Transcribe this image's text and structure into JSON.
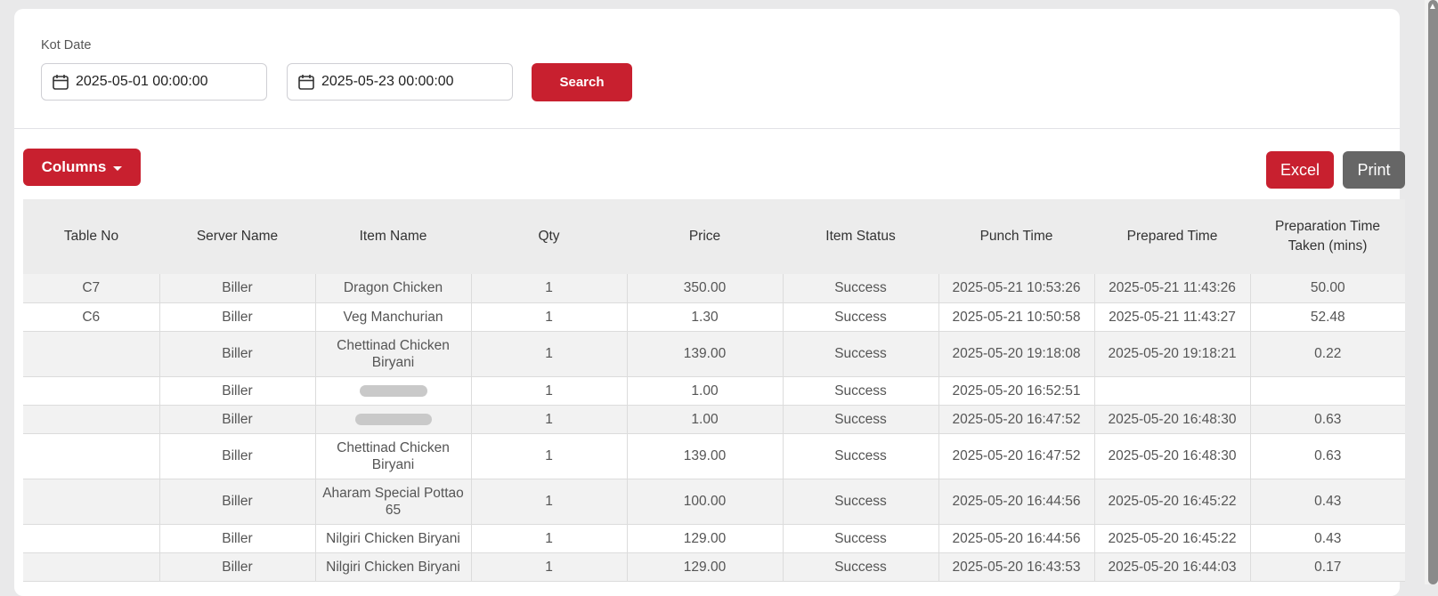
{
  "filters": {
    "label": "Kot Date",
    "from_date": "2025-05-01 00:00:00",
    "to_date": "2025-05-23 00:00:00",
    "search_label": "Search"
  },
  "toolbar": {
    "columns_label": "Columns",
    "excel_label": "Excel",
    "print_label": "Print"
  },
  "colors": {
    "accent": "#c8202f",
    "print_button": "#666666",
    "header_bg": "#ececec"
  },
  "table": {
    "headers": [
      "Table No",
      "Server Name",
      "Item Name",
      "Qty",
      "Price",
      "Item Status",
      "Punch Time",
      "Prepared Time",
      "Preparation Time Taken (mins)"
    ],
    "rows": [
      {
        "table_no": "C7",
        "server": "Biller",
        "item": "Dragon Chicken",
        "qty": "1",
        "price": "350.00",
        "status": "Success",
        "punch": "2025-05-21 10:53:26",
        "prepared": "2025-05-21 11:43:26",
        "taken": "50.00"
      },
      {
        "table_no": "C6",
        "server": "Biller",
        "item": "Veg Manchurian",
        "qty": "1",
        "price": "1.30",
        "status": "Success",
        "punch": "2025-05-21 10:50:58",
        "prepared": "2025-05-21 11:43:27",
        "taken": "52.48"
      },
      {
        "table_no": "",
        "server": "Biller",
        "item": "Chettinad Chicken Biryani",
        "qty": "1",
        "price": "139.00",
        "status": "Success",
        "punch": "2025-05-20 19:18:08",
        "prepared": "2025-05-20 19:18:21",
        "taken": "0.22"
      },
      {
        "table_no": "",
        "server": "Biller",
        "item": "",
        "qty": "1",
        "price": "1.00",
        "status": "Success",
        "punch": "2025-05-20 16:52:51",
        "prepared": "",
        "taken": ""
      },
      {
        "table_no": "",
        "server": "Biller",
        "item": "",
        "qty": "1",
        "price": "1.00",
        "status": "Success",
        "punch": "2025-05-20 16:47:52",
        "prepared": "2025-05-20 16:48:30",
        "taken": "0.63"
      },
      {
        "table_no": "",
        "server": "Biller",
        "item": "Chettinad Chicken Biryani",
        "qty": "1",
        "price": "139.00",
        "status": "Success",
        "punch": "2025-05-20 16:47:52",
        "prepared": "2025-05-20 16:48:30",
        "taken": "0.63"
      },
      {
        "table_no": "",
        "server": "Biller",
        "item": "Aharam Special Pottao 65",
        "qty": "1",
        "price": "100.00",
        "status": "Success",
        "punch": "2025-05-20 16:44:56",
        "prepared": "2025-05-20 16:45:22",
        "taken": "0.43"
      },
      {
        "table_no": "",
        "server": "Biller",
        "item": "Nilgiri Chicken Biryani",
        "qty": "1",
        "price": "129.00",
        "status": "Success",
        "punch": "2025-05-20 16:44:56",
        "prepared": "2025-05-20 16:45:22",
        "taken": "0.43"
      },
      {
        "table_no": "",
        "server": "Biller",
        "item": "Nilgiri Chicken Biryani",
        "qty": "1",
        "price": "129.00",
        "status": "Success",
        "punch": "2025-05-20 16:43:53",
        "prepared": "2025-05-20 16:44:03",
        "taken": "0.17"
      }
    ]
  }
}
